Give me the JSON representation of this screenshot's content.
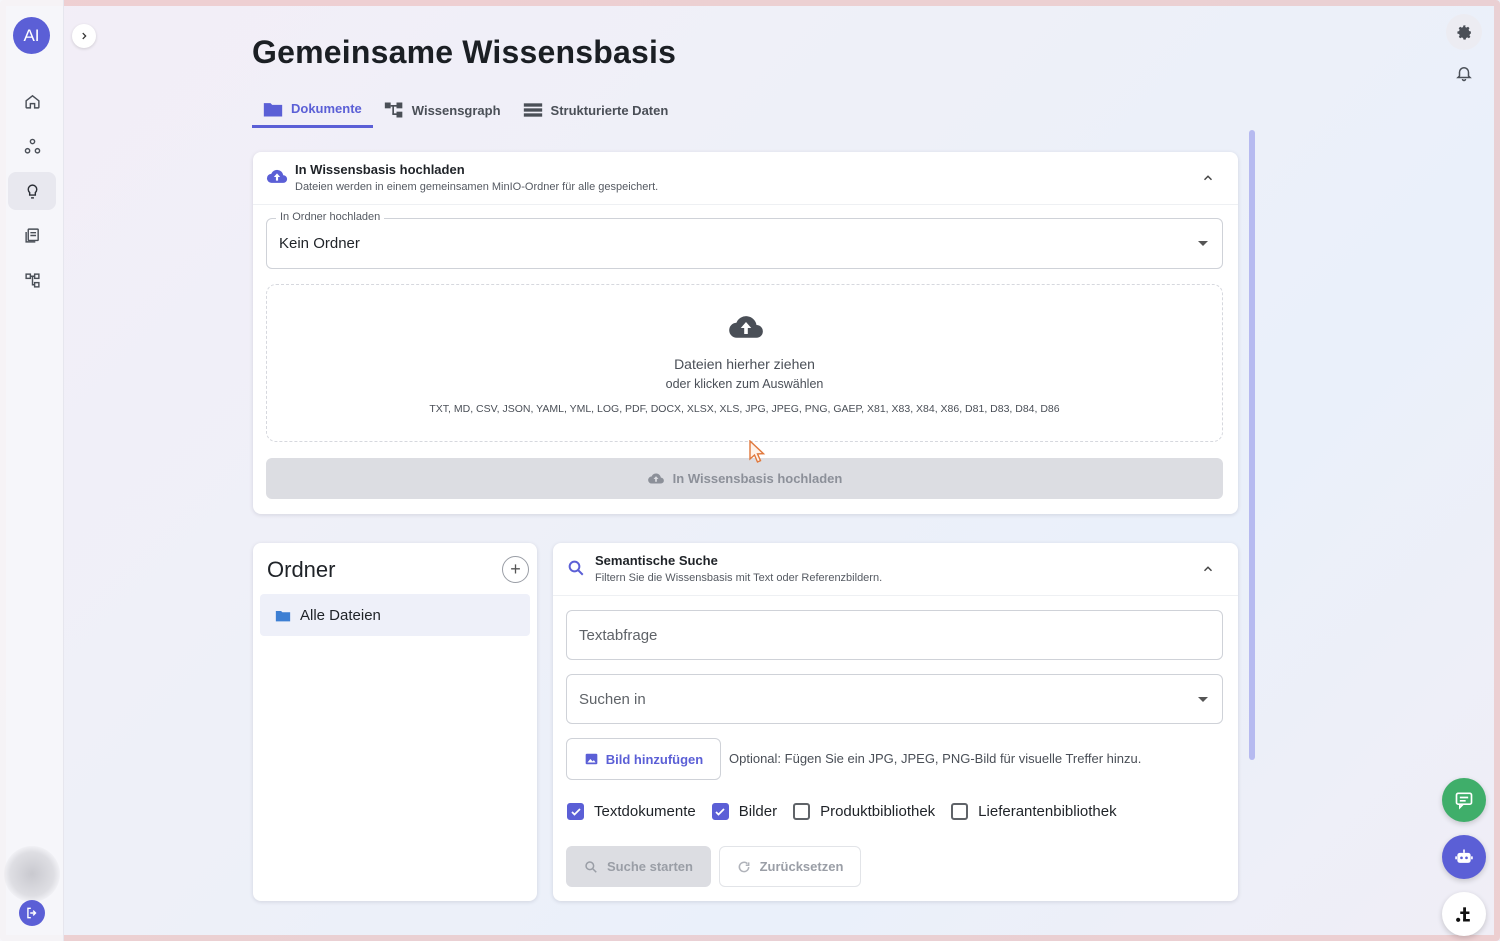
{
  "app": {
    "avatar_label": "AI"
  },
  "page": {
    "title": "Gemeinsame Wissensbasis"
  },
  "tabs": [
    {
      "label": "Dokumente",
      "active": true,
      "icon": "folder-icon"
    },
    {
      "label": "Wissensgraph",
      "active": false,
      "icon": "graph-icon"
    },
    {
      "label": "Strukturierte Daten",
      "active": false,
      "icon": "table-icon"
    }
  ],
  "upload": {
    "title": "In Wissensbasis hochladen",
    "subtitle": "Dateien werden in einem gemeinsamen MinIO-Ordner für alle gespeichert.",
    "folder_field_label": "In Ordner hochladen",
    "folder_field_value": "Kein Ordner",
    "dropzone_main": "Dateien hierher ziehen",
    "dropzone_sub": "oder klicken zum Auswählen",
    "dropzone_types": "TXT, MD, CSV, JSON, YAML, YML, LOG, PDF, DOCX, XLSX, XLS, JPG, JPEG, PNG, GAEP, X81, X83, X84, X86, D81, D83, D84, D86",
    "button_label": "In Wissensbasis hochladen"
  },
  "folders": {
    "title": "Ordner",
    "items": [
      {
        "label": "Alle Dateien",
        "selected": true
      }
    ]
  },
  "search": {
    "title": "Semantische Suche",
    "subtitle": "Filtern Sie die Wissensbasis mit Text oder Referenzbildern.",
    "query_placeholder": "Textabfrage",
    "scope_placeholder": "Suchen in",
    "add_image_label": "Bild hinzufügen",
    "add_image_hint": "Optional: Fügen Sie ein JPG, JPEG, PNG-Bild für visuelle Treffer hinzu.",
    "filters": [
      {
        "label": "Textdokumente",
        "checked": true
      },
      {
        "label": "Bilder",
        "checked": true
      },
      {
        "label": "Produktbibliothek",
        "checked": false
      },
      {
        "label": "Lieferantenbibliothek",
        "checked": false
      }
    ],
    "start_label": "Suche starten",
    "reset_label": "Zurücksetzen"
  },
  "colors": {
    "accent": "#5b5fd6",
    "chat_fab": "#3fae6a",
    "bot_fab": "#5b5fd6"
  }
}
